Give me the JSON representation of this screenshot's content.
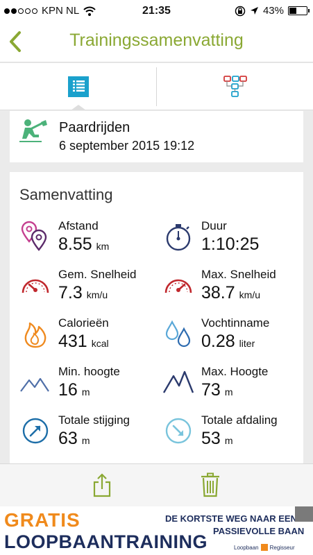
{
  "status": {
    "carrier": "KPN NL",
    "time": "21:35",
    "battery": "43%",
    "battery_level": 0.43
  },
  "nav": {
    "title": "Trainingssamenvatting"
  },
  "activity": {
    "name": "Paardrijden",
    "date": "6 september 2015 19:12"
  },
  "summary": {
    "title": "Samenvatting",
    "metrics": [
      {
        "label": "Afstand",
        "value": "8.55",
        "unit": "km",
        "icon": "map-pin-icon"
      },
      {
        "label": "Duur",
        "value": "1:10:25",
        "unit": "",
        "icon": "stopwatch-icon"
      },
      {
        "label": "Gem. Snelheid",
        "value": "7.3",
        "unit": "km/u",
        "icon": "speedometer-icon"
      },
      {
        "label": "Max. Snelheid",
        "value": "38.7",
        "unit": "km/u",
        "icon": "speedometer-max-icon"
      },
      {
        "label": "Calorieën",
        "value": "431",
        "unit": "kcal",
        "icon": "flame-icon"
      },
      {
        "label": "Vochtinname",
        "value": "0.28",
        "unit": "liter",
        "icon": "water-drops-icon"
      },
      {
        "label": "Min. hoogte",
        "value": "16",
        "unit": "m",
        "icon": "mountain-low-icon"
      },
      {
        "label": "Max. Hoogte",
        "value": "73",
        "unit": "m",
        "icon": "mountain-high-icon"
      },
      {
        "label": "Totale stijging",
        "value": "63",
        "unit": "m",
        "icon": "ascent-arrow-icon"
      },
      {
        "label": "Totale afdaling",
        "value": "53",
        "unit": "m",
        "icon": "descent-arrow-icon"
      }
    ]
  },
  "ad": {
    "line1": "GRATIS",
    "line2": "LOOPBAANTRAINING",
    "right1": "DE KORTSTE WEG NAAR EEN",
    "right2": "PASSIEVOLLE BAAN",
    "brand1": "Loopbaan",
    "brand2": "Regisseur"
  },
  "colors": {
    "accent": "#8aa833",
    "tab_blue": "#1ba1cc",
    "red": "#c0282d",
    "orange": "#ef8a1f",
    "navy": "#2b3a6d",
    "light_blue": "#5aa8d8"
  }
}
